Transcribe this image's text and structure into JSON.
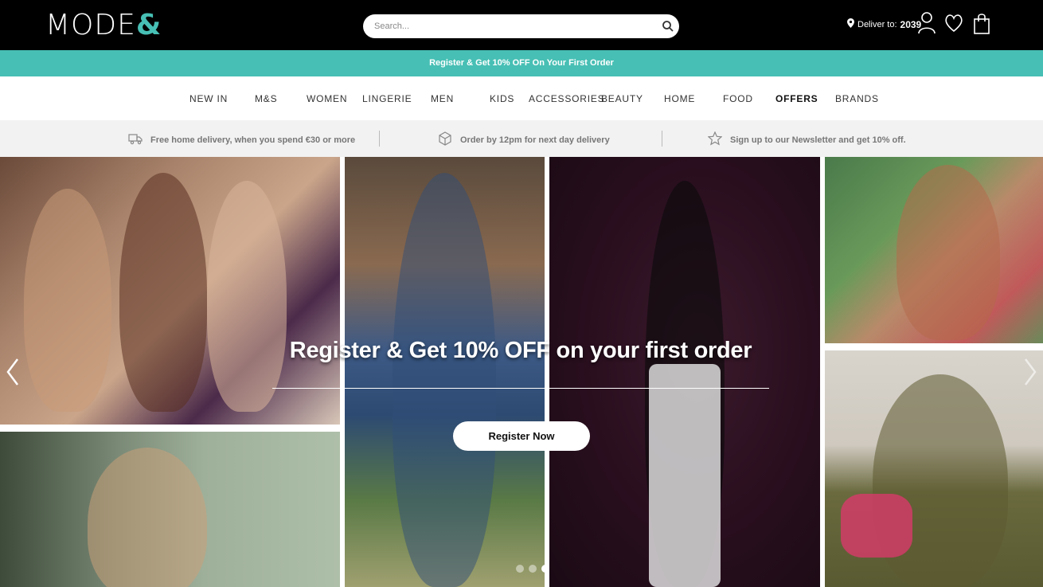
{
  "header": {
    "logo_main": "MODE",
    "logo_accent": "&",
    "search_placeholder": "Search...",
    "deliver_label": "Deliver to:",
    "deliver_value": "2039",
    "icons": [
      "location-pin-icon",
      "search-icon",
      "account-icon",
      "wishlist-heart-icon",
      "shopping-bag-icon"
    ]
  },
  "promo_bar": {
    "text": "Register & Get 10% OFF On Your First Order",
    "color": "#47bfb4"
  },
  "nav": {
    "items": [
      {
        "label": "NEW IN"
      },
      {
        "label": "M&S"
      },
      {
        "label": "WOMEN"
      },
      {
        "label": "LINGERIE"
      },
      {
        "label": "MEN"
      },
      {
        "label": "KIDS"
      },
      {
        "label": "ACCESSORIES"
      },
      {
        "label": "BEAUTY"
      },
      {
        "label": "HOME"
      },
      {
        "label": "FOOD"
      },
      {
        "label": "OFFERS"
      },
      {
        "label": "BRANDS"
      }
    ]
  },
  "usp": {
    "items": [
      {
        "text": "Free home delivery, when you spend €30 or more",
        "icon": "truck-icon"
      },
      {
        "text": "Order by 12pm for next day delivery",
        "icon": "box-icon"
      },
      {
        "text": "Sign up to our Newsletter and get 10% off.",
        "icon": "star-icon"
      }
    ]
  },
  "hero": {
    "title": "Register & Get 10% OFF on your first order",
    "button_label": "Register Now",
    "slides_total": 3,
    "active_slide": 3,
    "icons": [
      "chevron-left-icon",
      "chevron-right-icon"
    ]
  }
}
